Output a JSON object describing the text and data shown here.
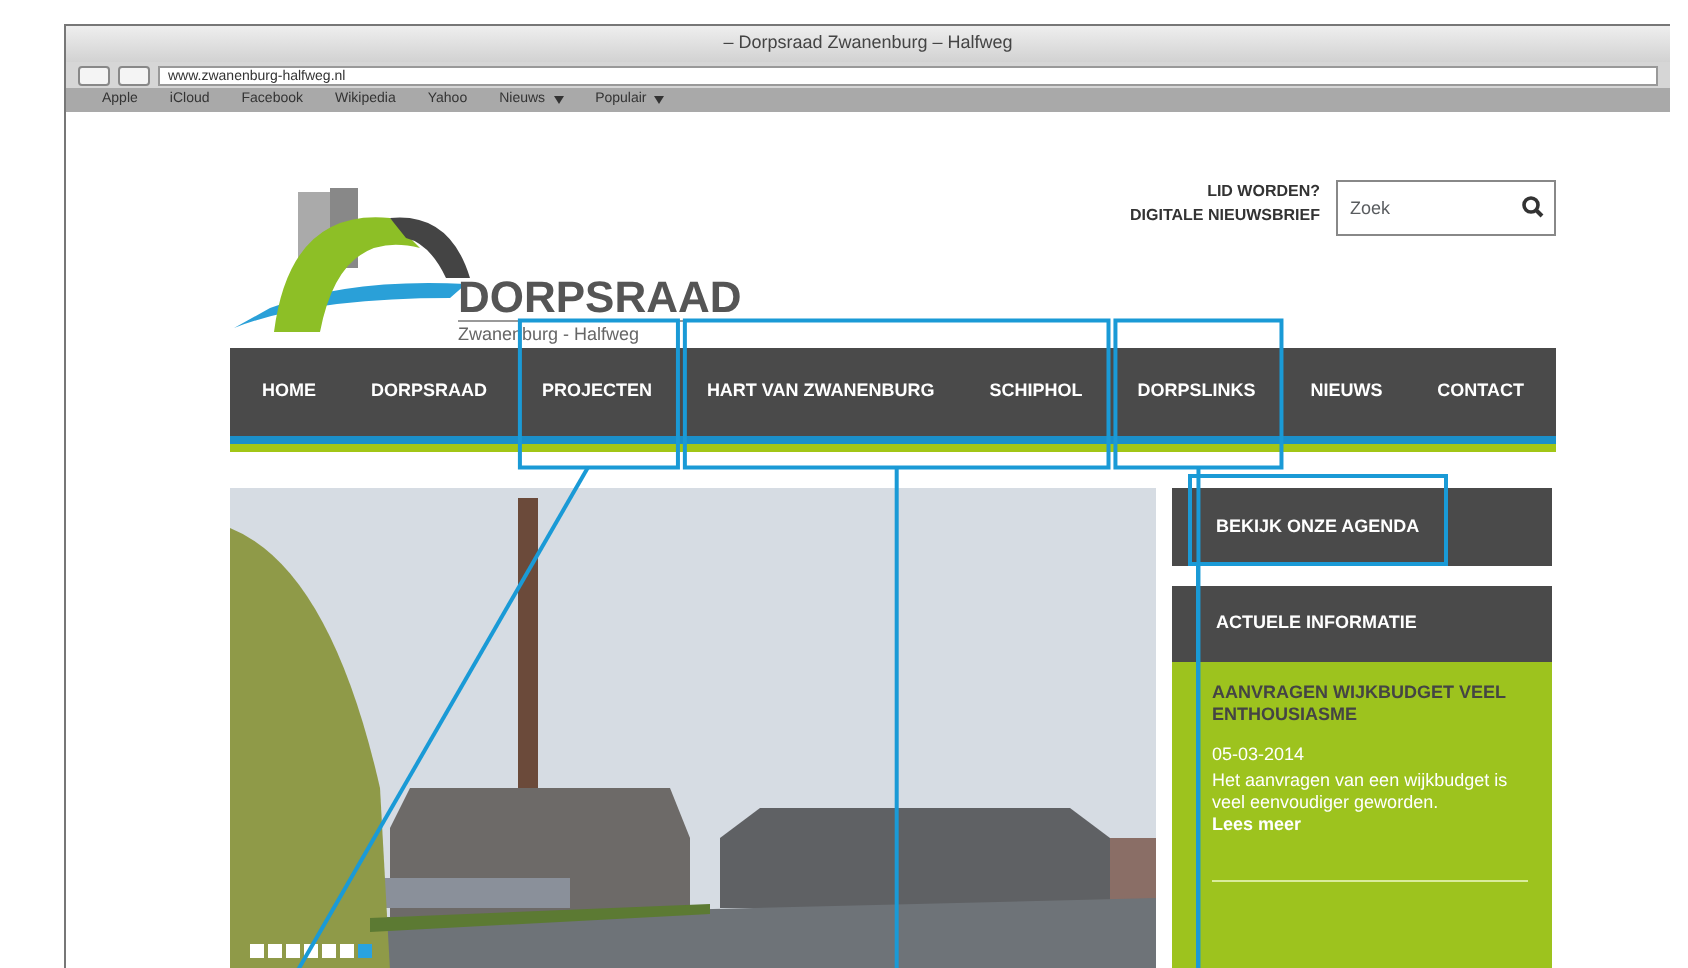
{
  "window": {
    "title": "– Dorpsraad Zwanenburg – Halfweg"
  },
  "address_bar": {
    "url": "www.zwanenburg-halfweg.nl"
  },
  "bookmarks": [
    {
      "label": "Apple",
      "menu": false
    },
    {
      "label": "iCloud",
      "menu": false
    },
    {
      "label": "Facebook",
      "menu": false
    },
    {
      "label": "Wikipedia",
      "menu": false
    },
    {
      "label": "Yahoo",
      "menu": false
    },
    {
      "label": "Nieuws",
      "menu": true
    },
    {
      "label": "Populair",
      "menu": true
    }
  ],
  "logo": {
    "name": "DORPSRAAD",
    "subtitle": "Zwanenburg - Halfweg"
  },
  "header_links": [
    "LID WORDEN?",
    "DIGITALE NIEUWSBRIEF"
  ],
  "search": {
    "placeholder": "Zoek"
  },
  "nav": [
    {
      "highlighted": false,
      "items": [
        "HOME"
      ]
    },
    {
      "highlighted": false,
      "items": [
        "DORPSRAAD"
      ]
    },
    {
      "highlighted": true,
      "items": [
        "PROJECTEN"
      ]
    },
    {
      "highlighted": true,
      "items": [
        "HART VAN ZWANENBURG",
        "SCHIPHOL"
      ]
    },
    {
      "highlighted": true,
      "items": [
        "DORPSLINKS"
      ]
    },
    {
      "highlighted": false,
      "items": [
        "NIEUWS"
      ]
    },
    {
      "highlighted": false,
      "items": [
        "CONTACT"
      ]
    }
  ],
  "slider": {
    "kind": "picture",
    "dots": [
      {
        "selected": false
      },
      {
        "selected": false
      },
      {
        "selected": false
      },
      {
        "selected": false
      },
      {
        "selected": false
      },
      {
        "selected": false
      },
      {
        "selected": true
      }
    ]
  },
  "agenda": {
    "label": "BEKIJK ONZE AGENDA",
    "highlighted": true
  },
  "news": {
    "title": "ACTUELE INFORMATIE",
    "items": [
      {
        "title": "AANVRAGEN WIJKBUDGET VEEL ENTHOUSIASME",
        "date": "05-03-2014",
        "text": "Het aanvragen van een wijkbudget is veel eenvoudiger geworden.",
        "link": "Lees meer"
      }
    ]
  }
}
